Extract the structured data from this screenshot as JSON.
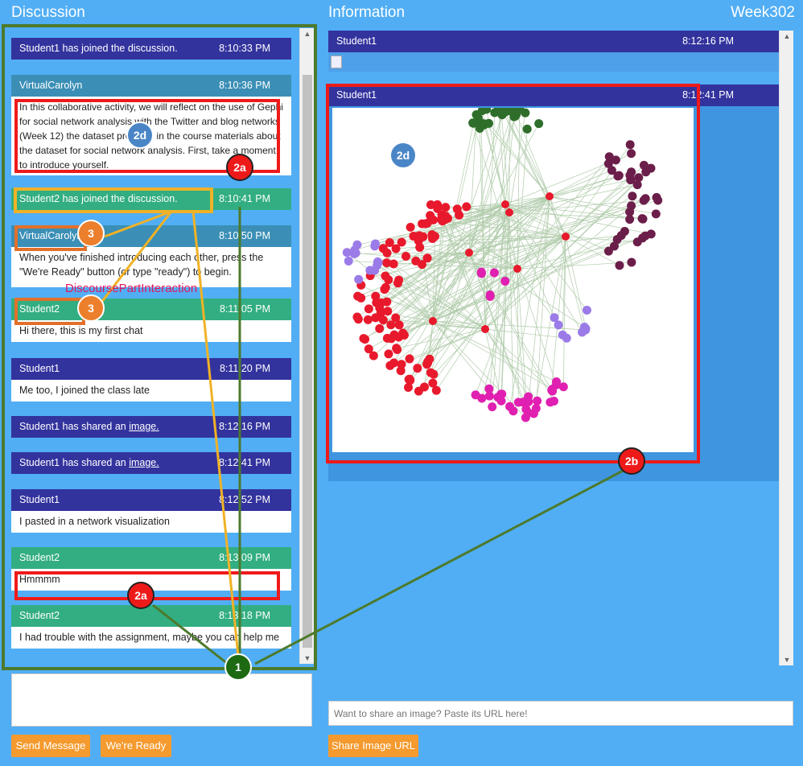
{
  "discussion": {
    "title": "Discussion",
    "messages": [
      {
        "header": "Student1 has joined the discussion.",
        "time": "8:10:33 PM",
        "style": "dark"
      },
      {
        "header": "VirtualCarolyn",
        "time": "8:10:36 PM",
        "style": "teal",
        "body": "In this collaborative activity, we will reflect on the use of Gephi for social network analysis with the Twitter and blog networks (Week 12) the dataset provided in the course materials about the dataset for social network analysis. First, take a moment to introduce yourself."
      },
      {
        "header": "Student2 has joined the discussion.",
        "time": "8:10:41 PM",
        "style": "green"
      },
      {
        "header": "VirtualCarolyn",
        "time": "8:10:50 PM",
        "style": "teal",
        "body": "When you've finished introducing each other, press the \"We're Ready\" button (or type \"ready\") to begin."
      },
      {
        "header": "Student2",
        "time": "8:11:05 PM",
        "style": "green",
        "body": "Hi there, this is my first chat"
      },
      {
        "header": "Student1",
        "time": "8:11:20 PM",
        "style": "dark",
        "body": "Me too, I joined the class late"
      },
      {
        "header_prefix": "Student1 has shared an ",
        "header_link": "image.",
        "time": "8:12:16 PM",
        "style": "dark"
      },
      {
        "header_prefix": "Student1 has shared an ",
        "header_link": "image.",
        "time": "8:12:41 PM",
        "style": "dark"
      },
      {
        "header": "Student1",
        "time": "8:12:52 PM",
        "style": "dark",
        "body": "I pasted in a network visualization"
      },
      {
        "header": "Student2",
        "time": "8:13:09 PM",
        "style": "green",
        "body": "Hmmmm"
      },
      {
        "header": "Student2",
        "time": "8:13:18 PM",
        "style": "green",
        "body": "I had trouble with the assignment, maybe you can help me"
      }
    ],
    "input_value": "",
    "send_label": "Send Message",
    "ready_label": "We're Ready"
  },
  "information": {
    "title": "Information",
    "week": "Week302",
    "items": [
      {
        "header": "Student1",
        "time": "8:12:16 PM"
      },
      {
        "header": "Student1",
        "time": "8:12:41 PM"
      }
    ],
    "url_placeholder": "Want to share an image? Paste its URL here!",
    "share_label": "Share Image URL"
  },
  "annotations": {
    "m1": "1",
    "m2a": "2a",
    "m2b": "2b",
    "m2d": "2d",
    "m3": "3",
    "interaction_label": "DiscoursePartInteraction"
  },
  "colors": {
    "background": "#51aef5",
    "header_dark": "#33339e",
    "header_teal": "#3b8fb6",
    "header_green": "#32ae82",
    "button": "#f59a2e",
    "annotation_red": "#ee1a1a",
    "annotation_orange": "#ec7f2b",
    "annotation_yellow": "#f0b226",
    "annotation_green": "#1d6a12",
    "network_red": "#e8192c",
    "network_green": "#2e6e2a",
    "network_purple": "#6b1e4a",
    "network_lavender": "#9b7be8",
    "network_magenta": "#e020b0"
  }
}
